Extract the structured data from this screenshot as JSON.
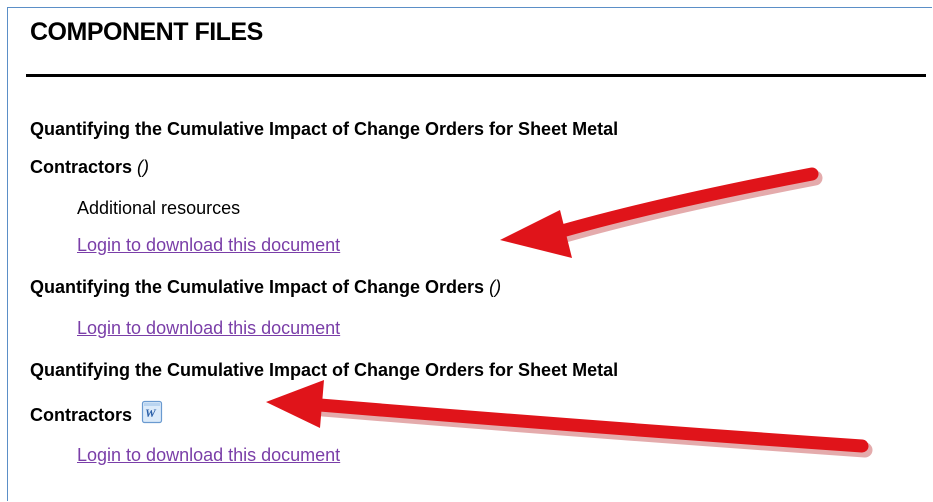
{
  "header": {
    "title": "COMPONENT FILES"
  },
  "files": [
    {
      "title_line1": "Quantifying the Cumulative Impact of Change Orders for Sheet Metal",
      "title_line2": "Contractors",
      "suffix": "()",
      "description": "Additional resources",
      "link": "Login to download this document"
    },
    {
      "title_line1": "Quantifying the Cumulative Impact of Change Orders",
      "suffix": "()",
      "link": "Login to download this document"
    },
    {
      "title_line1": "Quantifying the Cumulative Impact of Change Orders for Sheet Metal",
      "title_line2": "Contractors",
      "icon": "word-document-icon",
      "link": "Login to download this document"
    }
  ],
  "colors": {
    "link": "#7a3ea8",
    "frame_border": "#5b8fc7",
    "arrow": "#e0141a"
  }
}
